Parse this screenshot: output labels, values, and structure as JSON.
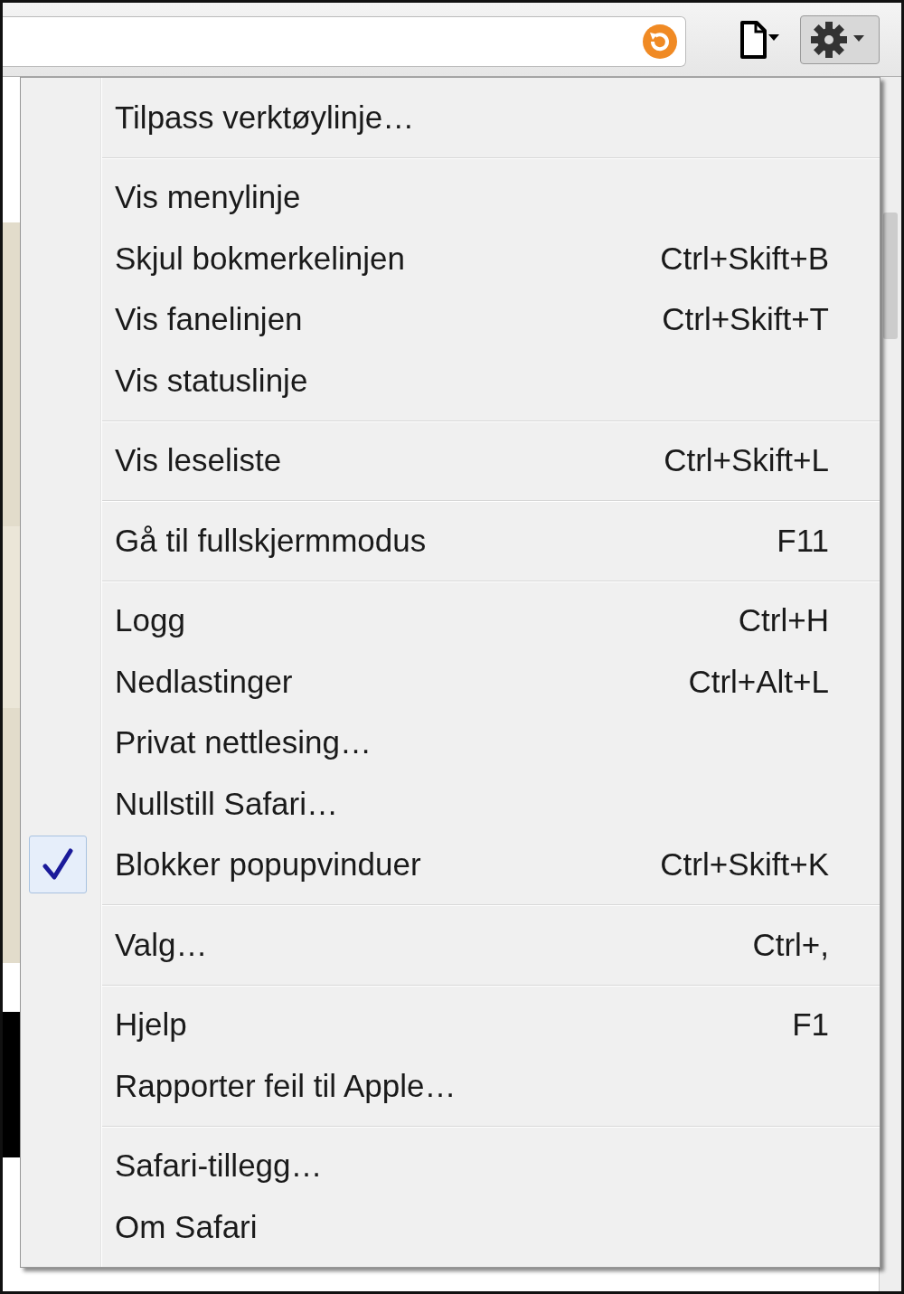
{
  "menu": {
    "groups": [
      {
        "items": [
          {
            "label": "Tilpass verktøylinje…",
            "checked": false
          }
        ]
      },
      {
        "items": [
          {
            "label": "Vis menylinje",
            "checked": false
          },
          {
            "label": "Skjul bokmerkelinjen",
            "shortcut": "Ctrl+Skift+B",
            "checked": false
          },
          {
            "label": "Vis fanelinjen",
            "shortcut": "Ctrl+Skift+T",
            "checked": false
          },
          {
            "label": "Vis statuslinje",
            "checked": false
          }
        ]
      },
      {
        "items": [
          {
            "label": "Vis leseliste",
            "shortcut": "Ctrl+Skift+L",
            "checked": false
          }
        ]
      },
      {
        "items": [
          {
            "label": "Gå til fullskjermmodus",
            "shortcut": "F11",
            "checked": false
          }
        ]
      },
      {
        "items": [
          {
            "label": "Logg",
            "shortcut": "Ctrl+H",
            "checked": false
          },
          {
            "label": "Nedlastinger",
            "shortcut": "Ctrl+Alt+L",
            "checked": false
          },
          {
            "label": "Privat nettlesing…",
            "checked": false
          },
          {
            "label": "Nullstill Safari…",
            "checked": false
          },
          {
            "label": "Blokker popupvinduer",
            "shortcut": "Ctrl+Skift+K",
            "checked": true
          }
        ]
      },
      {
        "items": [
          {
            "label": "Valg…",
            "shortcut": "Ctrl+,",
            "checked": false
          }
        ]
      },
      {
        "items": [
          {
            "label": "Hjelp",
            "shortcut": "F1",
            "checked": false
          },
          {
            "label": "Rapporter feil til Apple…",
            "checked": false
          }
        ]
      },
      {
        "items": [
          {
            "label": "Safari-tillegg…",
            "checked": false
          },
          {
            "label": "Om Safari",
            "checked": false
          }
        ]
      }
    ]
  }
}
